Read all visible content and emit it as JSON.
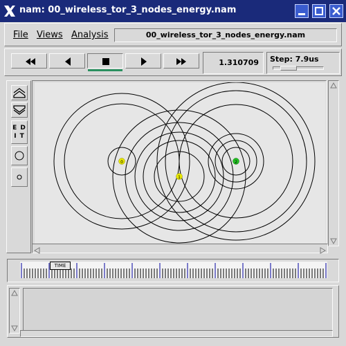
{
  "window": {
    "title": "nam: 00_wireless_tor_3_nodes_energy.nam",
    "colors": {
      "titlebar": "#1a2a7a",
      "node_yellow": "#e8e800",
      "node_green": "#22c022"
    }
  },
  "menu": {
    "file": "File",
    "views": "Views",
    "analysis": "Analysis",
    "filename": "00_wireless_tor_3_nodes_energy.nam"
  },
  "controls": {
    "buttons": [
      "rewind-icon",
      "back-icon",
      "stop-icon",
      "play-icon",
      "fast-forward-icon"
    ],
    "active": "stop",
    "time": "1.310709",
    "step_label": "Step: 7.9us"
  },
  "tools": {
    "edit_label_1": "E D",
    "edit_label_2": "I T"
  },
  "canvas": {
    "nodes": [
      {
        "id": "0",
        "color": "#e8e800"
      },
      {
        "id": "1",
        "color": "#e8e800"
      },
      {
        "id": "2",
        "color": "#22c022"
      }
    ]
  },
  "timeline": {
    "tag": "TIME"
  }
}
